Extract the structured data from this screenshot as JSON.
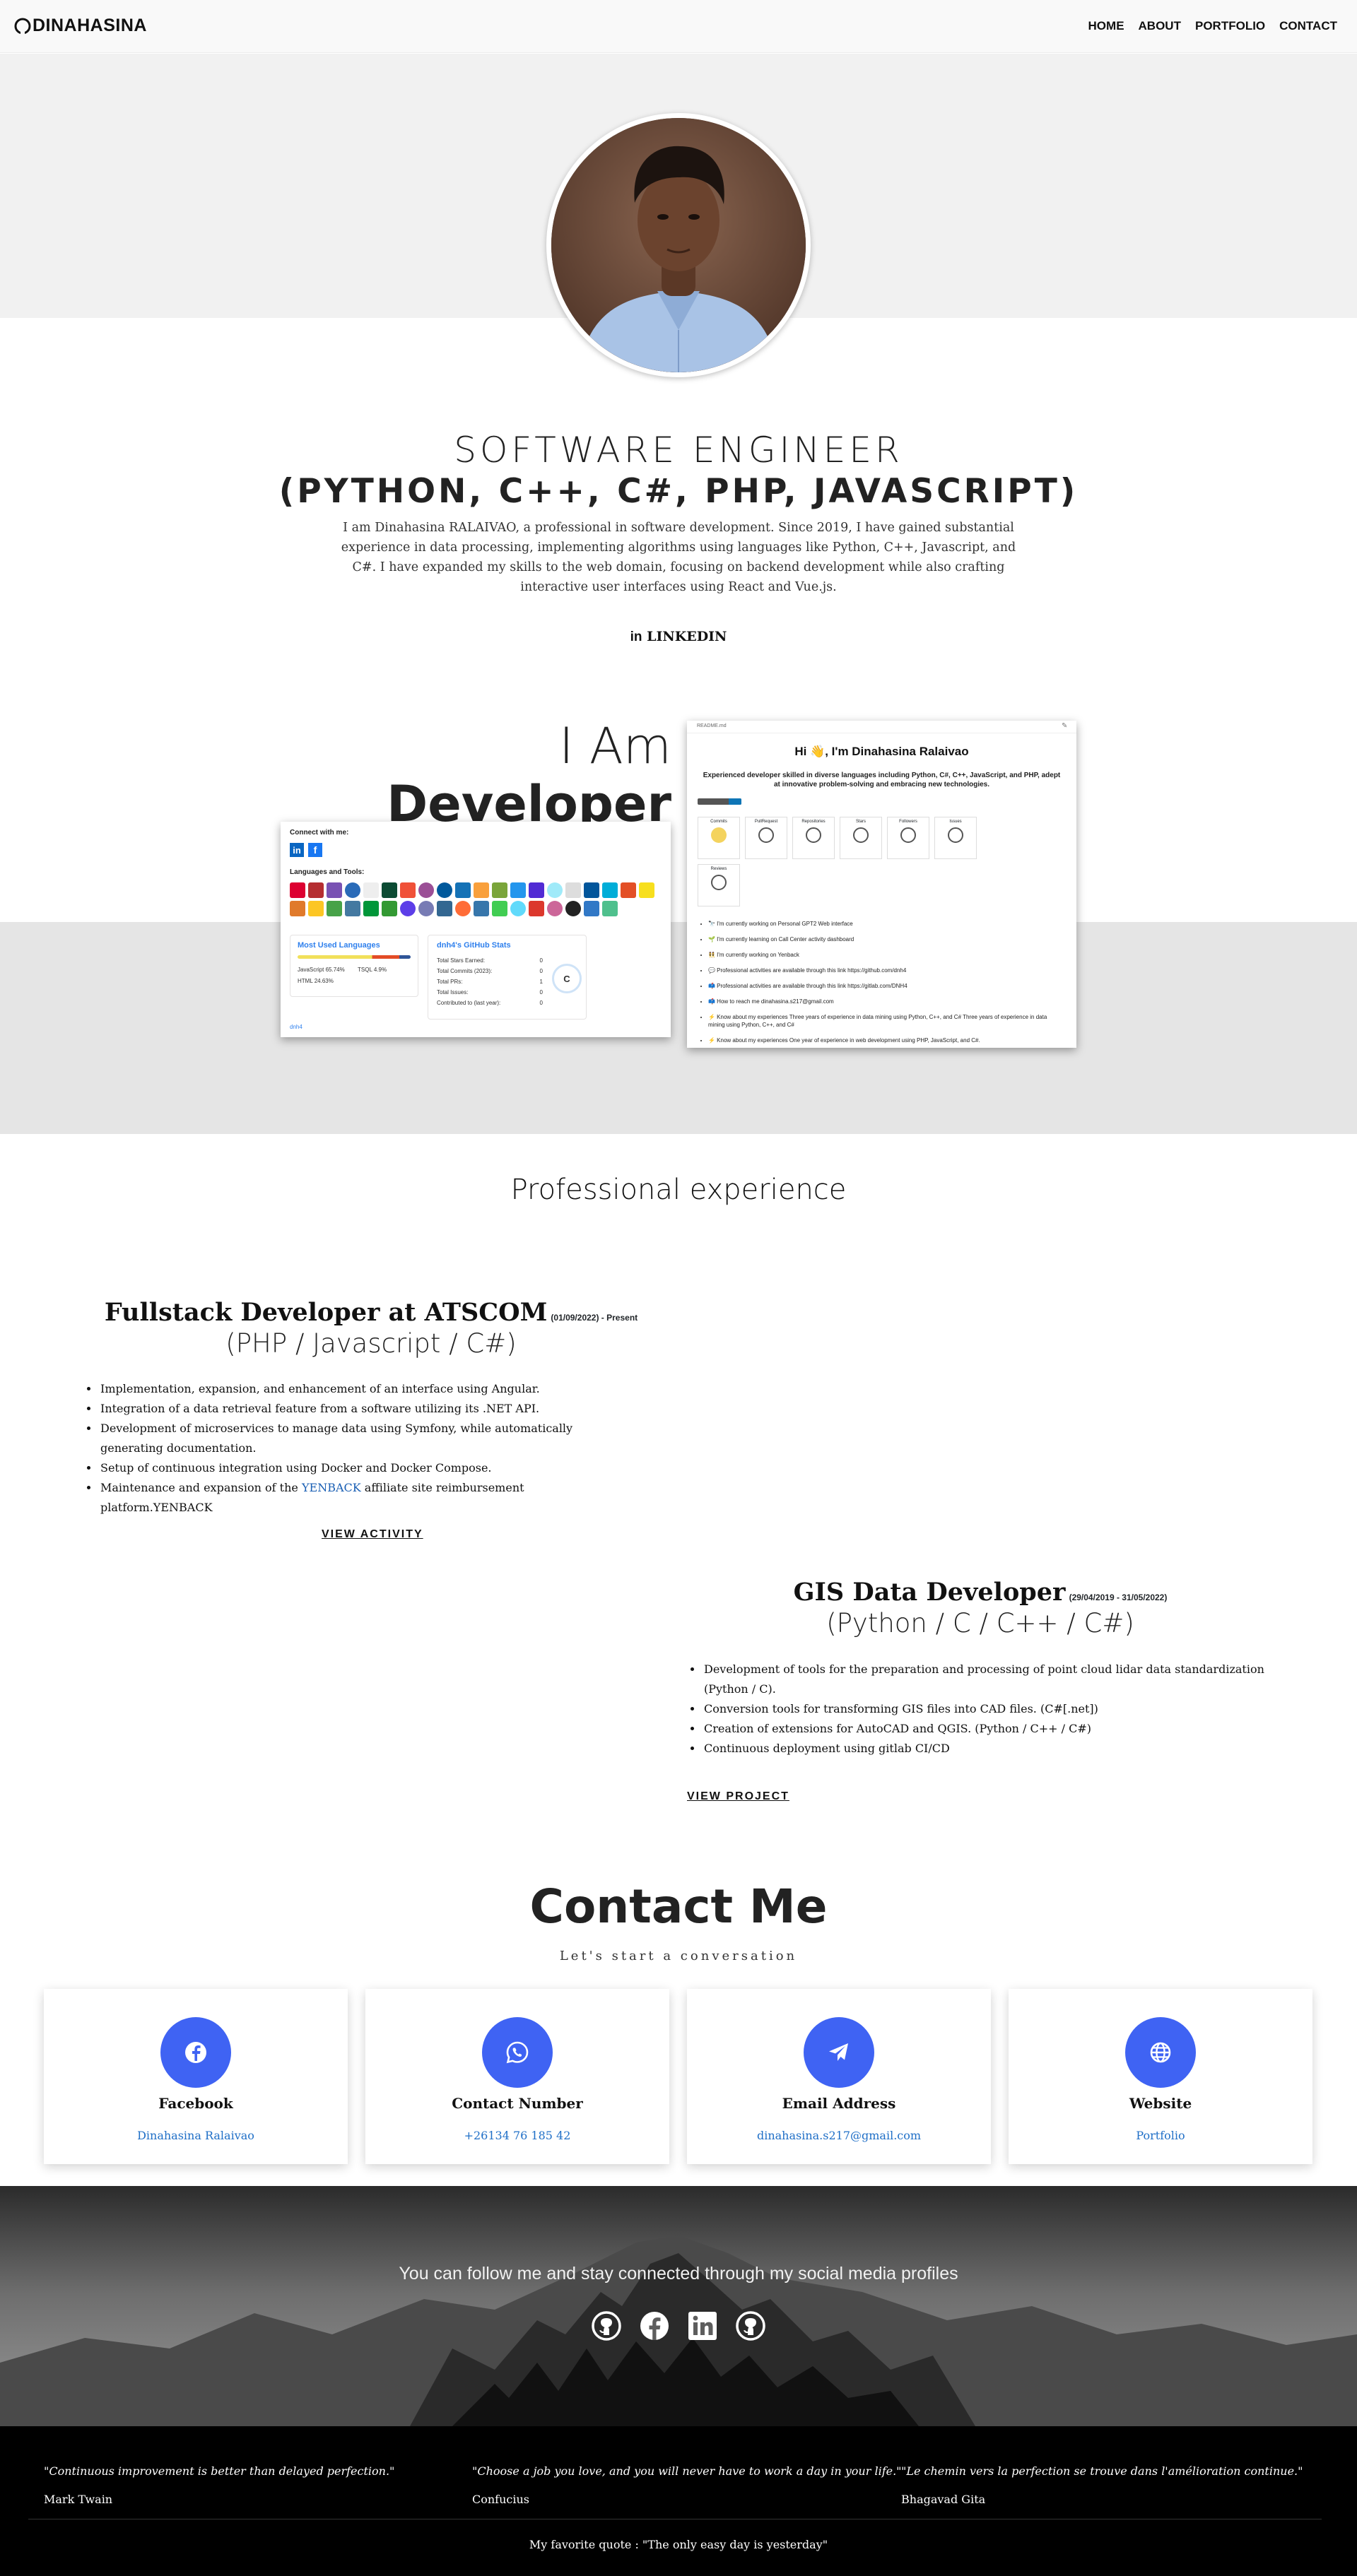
{
  "nav": {
    "brand": "DINAHASINA",
    "items": [
      "HOME",
      "ABOUT",
      "PORTFOLIO",
      "CONTACT"
    ]
  },
  "hero": {
    "title_line1": "SOFTWARE ENGINEER",
    "title_line2": "(PYTHON, C++, C#, PHP, JAVASCRIPT)",
    "description": "I am Dinahasina RALAIVAO, a professional in software development. Since 2019, I have gained substantial experience in data processing, implementing algorithms using languages like Python, C++, Javascript, and C#. I have expanded my skills to the web domain, focusing on backend development while also crafting interactive user interfaces using React and Vue.js.",
    "linkedin_label": "LINKEDIN"
  },
  "developer": {
    "heading_light": "I Am",
    "heading_bold": "Developer",
    "left_card": {
      "connect_label": "Connect with me:",
      "languages_label": "Languages and Tools:",
      "most_used_title": "Most Used Languages",
      "lang1": "JavaScript 65.74%",
      "lang2": "TSQL 4.9%",
      "lang3": "HTML 24.63%",
      "stats_title": "dnh4's GitHub Stats",
      "stats": [
        {
          "label": "Total Stars Earned:",
          "value": "0"
        },
        {
          "label": "Total Commits (2023):",
          "value": "0"
        },
        {
          "label": "Total PRs:",
          "value": "1"
        },
        {
          "label": "Total Issues:",
          "value": "0"
        },
        {
          "label": "Contributed to (last year):",
          "value": "0"
        }
      ],
      "grade": "C",
      "broken_img_alt": "dnh4"
    },
    "right_card": {
      "filename": "README.md",
      "greeting": "Hi 👋, I'm Dinahasina Ralaivao",
      "subtitle": "Experienced developer skilled in diverse languages including Python, C#, C++, JavaScript, and PHP, adept at innovative problem-solving and embracing new technologies.",
      "trophies": [
        "Commits",
        "PullRequest",
        "Repositories",
        "Stars",
        "Followers",
        "Issues",
        "Reviews"
      ],
      "bullets": [
        "🔭 I'm currently working on Personal GPT2 Web interface",
        "🌱 I'm currently learning on Call Center activity dashboard",
        "👯 I'm currently working on Yenback",
        "💬 Professional activities are available through this link https://github.com/dnh4",
        "📫 Professional activities are available through this link https://gitlab.com/DNH4",
        "📫 How to reach me dinahasina.s217@gmail.com",
        "⚡ Know about my experiences Three years of experience in data mining using Python, C++, and C# Three years of experience in data mining using Python, C++, and C#",
        "⚡ Know about my experiences One year of experience in web development using PHP, JavaScript, and C#."
      ]
    }
  },
  "experience": {
    "section_title": "Professional experience",
    "jobs": [
      {
        "title": "Fullstack Developer at ATSCOM",
        "date": "(01/09/2022) - Present",
        "stack": "(PHP / Javascript / C#)",
        "items": [
          "Implementation, expansion, and enhancement of an interface using Angular.",
          "Integration of a data retrieval feature from a software utilizing its .NET API.",
          "Development of microservices to manage data using Symfony, while automatically generating documentation.",
          "Setup of continuous integration using Docker and Docker Compose."
        ],
        "last_item_prefix": "Maintenance and expansion of the",
        "last_item_link": "YENBACK",
        "last_item_suffix": "affiliate site reimbursement platform.YENBACK",
        "link_label": "VIEW ACTIVITY"
      },
      {
        "title": "GIS Data Developer",
        "date": "(29/04/2019 - 31/05/2022)",
        "stack": "(Python / C / C++ / C#)",
        "items": [
          "Development of tools for the preparation and processing of point cloud lidar data standardization (Python / C).",
          "Conversion tools for transforming GIS files into CAD files. (C#[.net])",
          "Creation of extensions for AutoCAD and QGIS. (Python / C++ / C#)",
          "Continuous deployment using gitlab CI/CD"
        ],
        "link_label": "VIEW PROJECT"
      }
    ]
  },
  "contact": {
    "title": "Contact Me",
    "subtitle": "Let's start a conversation",
    "cards": [
      {
        "title": "Facebook",
        "value": "Dinahasina Ralaivao",
        "icon": "facebook-icon"
      },
      {
        "title": "Contact Number",
        "value": "+26134 76 185 42",
        "icon": "whatsapp-icon"
      },
      {
        "title": "Email Address",
        "value": "dinahasina.s217@gmail.com",
        "icon": "paper-plane-icon"
      },
      {
        "title": "Website",
        "value": "Portfolio",
        "icon": "globe-icon"
      }
    ],
    "accent": "#3f63f3"
  },
  "follow": {
    "text": "You can follow me and stay connected through my social media profiles",
    "icons": [
      "github-icon",
      "facebook-icon",
      "linkedin-icon",
      "github-icon"
    ]
  },
  "footer": {
    "quotes": [
      {
        "text": "\"Continuous improvement is better than delayed perfection.\"",
        "author": "Mark Twain"
      },
      {
        "text": "\"Choose a job you love, and you will never have to work a day in your life.\"",
        "author": "Confucius"
      },
      {
        "text": "\"Le chemin vers la perfection se trouve dans l'amélioration continue.\"",
        "author": "Bhagavad Gita"
      }
    ],
    "favorite": "My favorite quote : \"The only easy day is yesterday\""
  }
}
